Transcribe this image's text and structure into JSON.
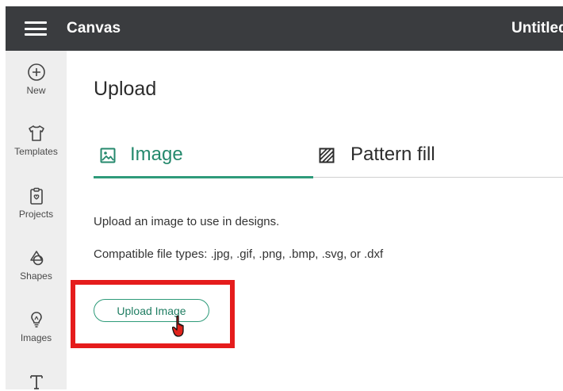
{
  "topbar": {
    "app_title": "Canvas",
    "doc_title": "Untitled",
    "menu_icon": "hamburger-menu-icon",
    "background": "#3a3c3f"
  },
  "sidebar": {
    "items": [
      {
        "label": "New",
        "icon": "plus-circle-icon"
      },
      {
        "label": "Templates",
        "icon": "tshirt-icon"
      },
      {
        "label": "Projects",
        "icon": "clipboard-icon"
      },
      {
        "label": "Shapes",
        "icon": "shapes-icon"
      },
      {
        "label": "Images",
        "icon": "lightbulb-icon"
      },
      {
        "label": "",
        "icon": "text-icon"
      }
    ]
  },
  "panel": {
    "title": "Upload",
    "tabs": [
      {
        "label": "Image",
        "icon": "image-icon",
        "active": true
      },
      {
        "label": "Pattern fill",
        "icon": "pattern-icon",
        "active": false
      }
    ],
    "description": "Upload an image to use in designs.",
    "file_types": "Compatible file types: .jpg, .gif, .png, .bmp, .svg, or .dxf",
    "upload_button_label": "Upload Image"
  },
  "colors": {
    "accent": "#2e9b7a",
    "highlight": "#e51c1c",
    "cursor": "#e0231c"
  }
}
